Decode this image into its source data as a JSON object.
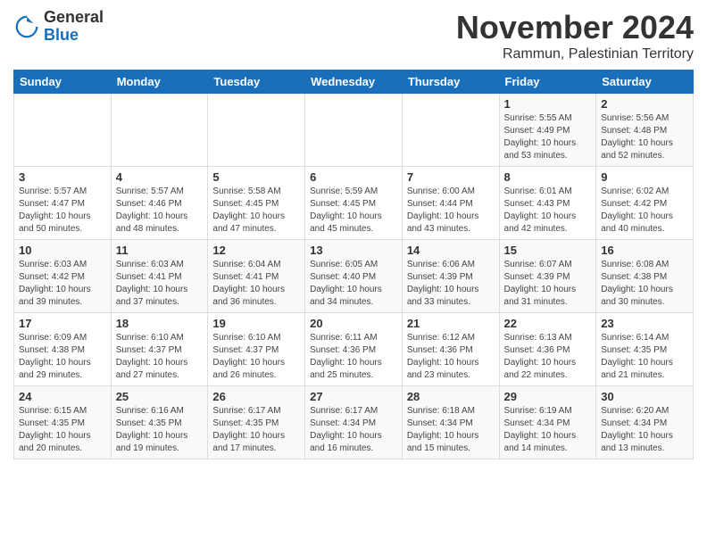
{
  "header": {
    "logo_general": "General",
    "logo_blue": "Blue",
    "month_title": "November 2024",
    "location": "Rammun, Palestinian Territory"
  },
  "days_of_week": [
    "Sunday",
    "Monday",
    "Tuesday",
    "Wednesday",
    "Thursday",
    "Friday",
    "Saturday"
  ],
  "weeks": [
    [
      {
        "day": "",
        "info": ""
      },
      {
        "day": "",
        "info": ""
      },
      {
        "day": "",
        "info": ""
      },
      {
        "day": "",
        "info": ""
      },
      {
        "day": "",
        "info": ""
      },
      {
        "day": "1",
        "info": "Sunrise: 5:55 AM\nSunset: 4:49 PM\nDaylight: 10 hours\nand 53 minutes."
      },
      {
        "day": "2",
        "info": "Sunrise: 5:56 AM\nSunset: 4:48 PM\nDaylight: 10 hours\nand 52 minutes."
      }
    ],
    [
      {
        "day": "3",
        "info": "Sunrise: 5:57 AM\nSunset: 4:47 PM\nDaylight: 10 hours\nand 50 minutes."
      },
      {
        "day": "4",
        "info": "Sunrise: 5:57 AM\nSunset: 4:46 PM\nDaylight: 10 hours\nand 48 minutes."
      },
      {
        "day": "5",
        "info": "Sunrise: 5:58 AM\nSunset: 4:45 PM\nDaylight: 10 hours\nand 47 minutes."
      },
      {
        "day": "6",
        "info": "Sunrise: 5:59 AM\nSunset: 4:45 PM\nDaylight: 10 hours\nand 45 minutes."
      },
      {
        "day": "7",
        "info": "Sunrise: 6:00 AM\nSunset: 4:44 PM\nDaylight: 10 hours\nand 43 minutes."
      },
      {
        "day": "8",
        "info": "Sunrise: 6:01 AM\nSunset: 4:43 PM\nDaylight: 10 hours\nand 42 minutes."
      },
      {
        "day": "9",
        "info": "Sunrise: 6:02 AM\nSunset: 4:42 PM\nDaylight: 10 hours\nand 40 minutes."
      }
    ],
    [
      {
        "day": "10",
        "info": "Sunrise: 6:03 AM\nSunset: 4:42 PM\nDaylight: 10 hours\nand 39 minutes."
      },
      {
        "day": "11",
        "info": "Sunrise: 6:03 AM\nSunset: 4:41 PM\nDaylight: 10 hours\nand 37 minutes."
      },
      {
        "day": "12",
        "info": "Sunrise: 6:04 AM\nSunset: 4:41 PM\nDaylight: 10 hours\nand 36 minutes."
      },
      {
        "day": "13",
        "info": "Sunrise: 6:05 AM\nSunset: 4:40 PM\nDaylight: 10 hours\nand 34 minutes."
      },
      {
        "day": "14",
        "info": "Sunrise: 6:06 AM\nSunset: 4:39 PM\nDaylight: 10 hours\nand 33 minutes."
      },
      {
        "day": "15",
        "info": "Sunrise: 6:07 AM\nSunset: 4:39 PM\nDaylight: 10 hours\nand 31 minutes."
      },
      {
        "day": "16",
        "info": "Sunrise: 6:08 AM\nSunset: 4:38 PM\nDaylight: 10 hours\nand 30 minutes."
      }
    ],
    [
      {
        "day": "17",
        "info": "Sunrise: 6:09 AM\nSunset: 4:38 PM\nDaylight: 10 hours\nand 29 minutes."
      },
      {
        "day": "18",
        "info": "Sunrise: 6:10 AM\nSunset: 4:37 PM\nDaylight: 10 hours\nand 27 minutes."
      },
      {
        "day": "19",
        "info": "Sunrise: 6:10 AM\nSunset: 4:37 PM\nDaylight: 10 hours\nand 26 minutes."
      },
      {
        "day": "20",
        "info": "Sunrise: 6:11 AM\nSunset: 4:36 PM\nDaylight: 10 hours\nand 25 minutes."
      },
      {
        "day": "21",
        "info": "Sunrise: 6:12 AM\nSunset: 4:36 PM\nDaylight: 10 hours\nand 23 minutes."
      },
      {
        "day": "22",
        "info": "Sunrise: 6:13 AM\nSunset: 4:36 PM\nDaylight: 10 hours\nand 22 minutes."
      },
      {
        "day": "23",
        "info": "Sunrise: 6:14 AM\nSunset: 4:35 PM\nDaylight: 10 hours\nand 21 minutes."
      }
    ],
    [
      {
        "day": "24",
        "info": "Sunrise: 6:15 AM\nSunset: 4:35 PM\nDaylight: 10 hours\nand 20 minutes."
      },
      {
        "day": "25",
        "info": "Sunrise: 6:16 AM\nSunset: 4:35 PM\nDaylight: 10 hours\nand 19 minutes."
      },
      {
        "day": "26",
        "info": "Sunrise: 6:17 AM\nSunset: 4:35 PM\nDaylight: 10 hours\nand 17 minutes."
      },
      {
        "day": "27",
        "info": "Sunrise: 6:17 AM\nSunset: 4:34 PM\nDaylight: 10 hours\nand 16 minutes."
      },
      {
        "day": "28",
        "info": "Sunrise: 6:18 AM\nSunset: 4:34 PM\nDaylight: 10 hours\nand 15 minutes."
      },
      {
        "day": "29",
        "info": "Sunrise: 6:19 AM\nSunset: 4:34 PM\nDaylight: 10 hours\nand 14 minutes."
      },
      {
        "day": "30",
        "info": "Sunrise: 6:20 AM\nSunset: 4:34 PM\nDaylight: 10 hours\nand 13 minutes."
      }
    ]
  ]
}
